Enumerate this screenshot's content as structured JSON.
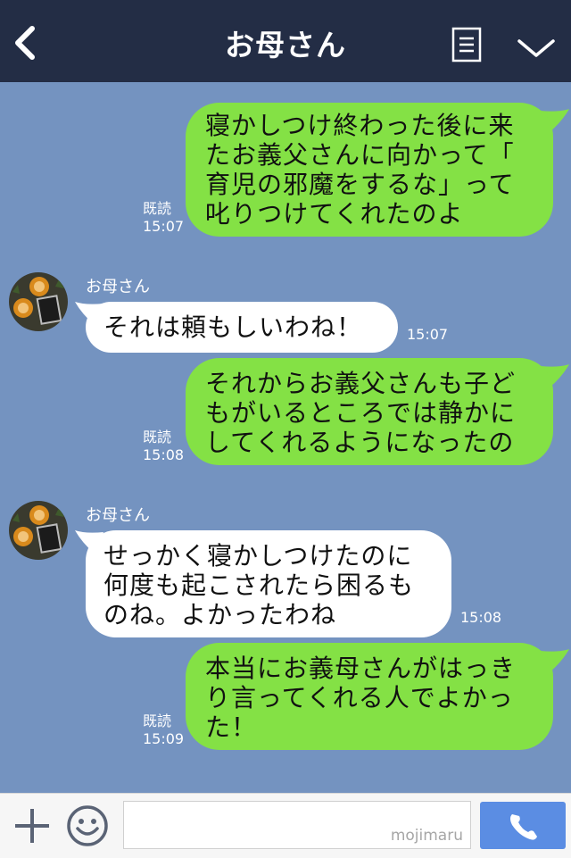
{
  "header": {
    "title": "お母さん"
  },
  "contact": {
    "name": "お母さん"
  },
  "messages": [
    {
      "side": "out",
      "text": "寝かしつけ終わった後に来\nたお義父さんに向かって「\n育児の邪魔をするな」って\n叱りつけてくれたのよ",
      "read": "既読",
      "time": "15:07"
    },
    {
      "side": "in",
      "text": "それは頼もしいわね！",
      "time": "15:07"
    },
    {
      "side": "out",
      "text": "それからお義父さんも子ど\nもがいるところでは静かに\nしてくれるようになったの",
      "read": "既読",
      "time": "15:08"
    },
    {
      "side": "in",
      "text": "せっかく寝かしつけたのに\n何度も起こされたら困るも\nのね。よかったわね",
      "time": "15:08"
    },
    {
      "side": "out",
      "text": "本当にお義母さんがはっき\nり言ってくれる人でよかっ\nた！",
      "read": "既読",
      "time": "15:09"
    }
  ],
  "input": {
    "watermark": "mojimaru"
  },
  "colors": {
    "header": "#232d45",
    "background": "#7493c0",
    "outgoing": "#84e145",
    "incoming": "#ffffff",
    "call_button": "#5b8de3"
  },
  "icons": [
    "back-arrow-icon",
    "menu-icon",
    "chevron-down-icon",
    "avatar",
    "plus-icon",
    "smiley-icon",
    "phone-icon"
  ]
}
